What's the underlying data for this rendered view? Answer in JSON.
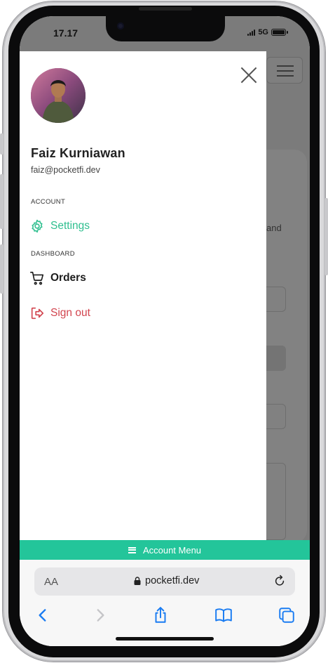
{
  "status_bar": {
    "time": "17.17",
    "network": "5G"
  },
  "background_page": {
    "partial_text": "and"
  },
  "drawer": {
    "user": {
      "name": "Faiz Kurniawan",
      "email": "faiz@pocketfi.dev"
    },
    "sections": [
      {
        "label": "ACCOUNT",
        "items": [
          {
            "label": "Settings",
            "icon": "gear-icon",
            "color": "#2fbf8f"
          }
        ]
      },
      {
        "label": "DASHBOARD",
        "items": [
          {
            "label": "Orders",
            "icon": "cart-icon",
            "color": "#1d1d1d"
          },
          {
            "label": "Sign out",
            "icon": "sign-out-icon",
            "color": "#d2454f"
          }
        ]
      }
    ]
  },
  "account_bar": {
    "label": "Account Menu",
    "color": "#23c59a"
  },
  "safari": {
    "text_size_label": "AA",
    "url": "pocketfi.dev",
    "toolbar": [
      "back-icon",
      "forward-icon",
      "share-icon",
      "bookmarks-icon",
      "tabs-icon"
    ]
  }
}
